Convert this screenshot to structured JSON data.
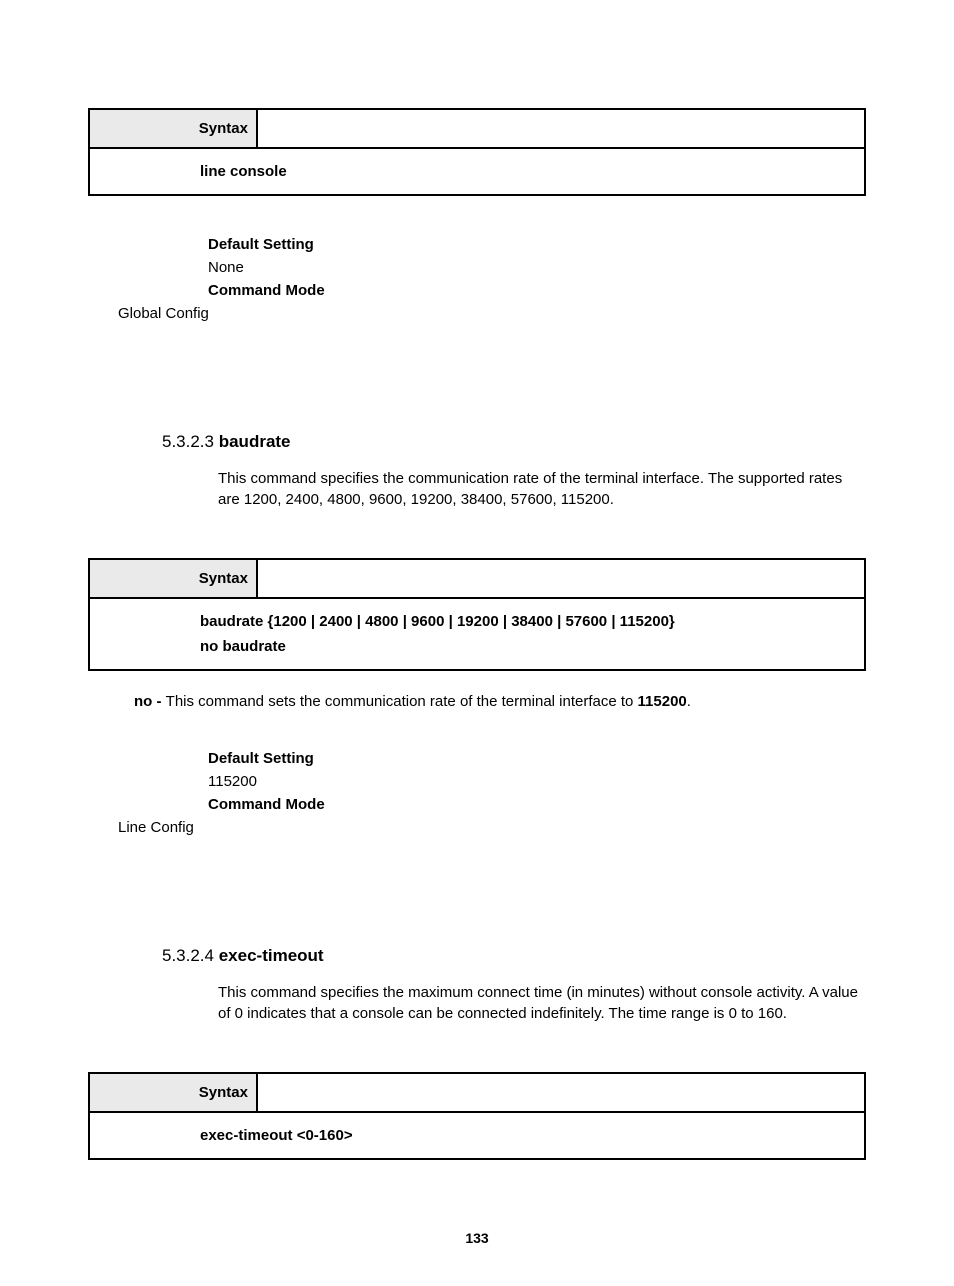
{
  "syntax1": {
    "label": "Syntax",
    "lines": [
      "line console"
    ]
  },
  "block1": {
    "defaultLabel": "Default Setting",
    "defaultValue": "None",
    "modeLabel": "Command Mode",
    "modeValue": "Global Config"
  },
  "sec523": {
    "num": "5.3.2.3 ",
    "title": "baudrate",
    "desc": "This command specifies the communication rate of the terminal interface. The supported rates are 1200, 2400, 4800, 9600, 19200, 38400, 57600, 115200."
  },
  "syntax2": {
    "label": "Syntax",
    "lines": [
      "baudrate {1200 | 2400 | 4800 | 9600 | 19200 | 38400 | 57600 | 115200}",
      "no baudrate"
    ]
  },
  "noLine523": {
    "prefix": "no - ",
    "middle": "This command sets the communication rate of the terminal interface to ",
    "value": "115200",
    "suffix": "."
  },
  "block2": {
    "defaultLabel": "Default Setting",
    "defaultValue": "115200",
    "modeLabel": "Command Mode",
    "modeValue": "Line Config"
  },
  "sec524": {
    "num": "5.3.2.4 ",
    "title": "exec-timeout",
    "desc": "This command specifies the maximum connect time (in minutes) without console activity. A value of 0 indicates that a console can be connected indefinitely. The time range is 0 to 160."
  },
  "syntax3": {
    "label": "Syntax",
    "lines": [
      "exec-timeout <0-160>"
    ]
  },
  "pageNumber": "133"
}
